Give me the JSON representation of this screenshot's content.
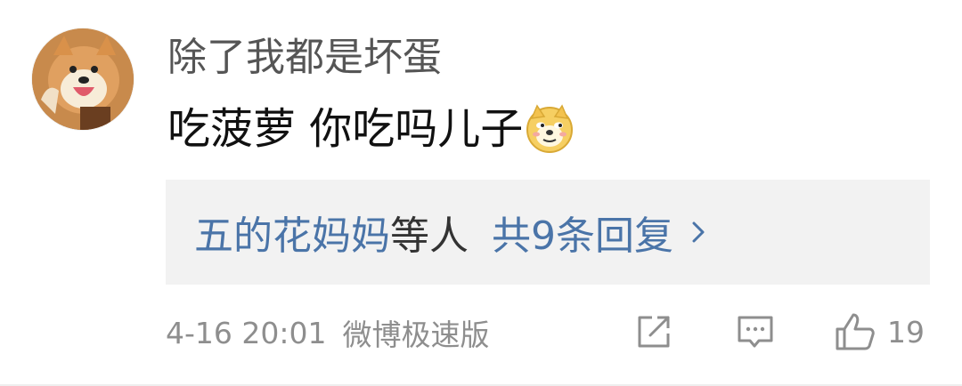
{
  "comment": {
    "username": "除了我都是坏蛋",
    "text": "吃菠萝 你吃吗儿子",
    "emoji": "doge-emoji",
    "replies": {
      "first_names": "五的花妈妈",
      "suffix": "等人",
      "count_label": "共9条回复"
    },
    "timestamp": "4-16 20:01",
    "source": "微博极速版",
    "like_count": "19"
  },
  "icons": {
    "share": "share-icon",
    "comment": "comment-icon",
    "like": "thumbs-up-icon",
    "chevron": "chevron-right-icon"
  },
  "colors": {
    "link": "#4a74a8",
    "meta": "#8e8e8e",
    "reply_bg": "#f2f2f2"
  }
}
